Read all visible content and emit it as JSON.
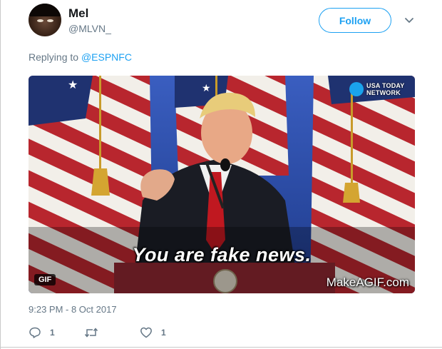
{
  "tweet": {
    "user_name": "Mel",
    "user_handle": "@MLVN_",
    "follow_label": "Follow",
    "reply_prefix": "Replying to",
    "reply_mention": "@ESPNFC",
    "timestamp": "9:23 PM - 8 Oct 2017"
  },
  "media": {
    "caption": "You are fake news.",
    "badge": "GIF",
    "watermark": "MakeAGIF.com",
    "network_logo_line1": "USA TODAY",
    "network_logo_line2": "NETWORK"
  },
  "actions": {
    "reply_count": "1",
    "retweet_count": "",
    "like_count": "1"
  },
  "colors": {
    "accent": "#1da1f2",
    "secondary_text": "#657786"
  },
  "icons": [
    "caret-down-icon",
    "reply-icon",
    "retweet-icon",
    "like-icon"
  ]
}
